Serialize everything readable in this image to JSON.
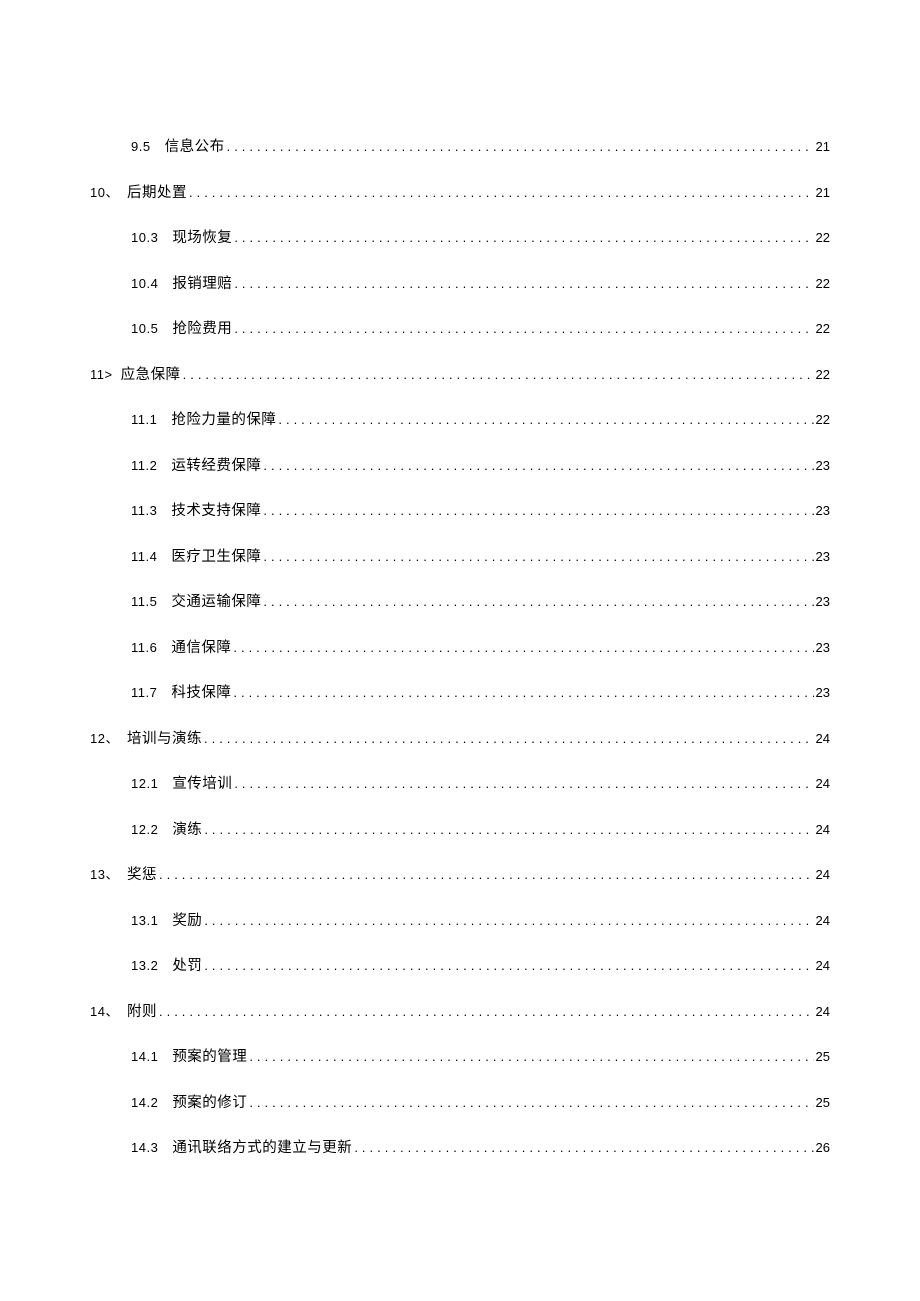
{
  "toc": [
    {
      "level": 2,
      "num": "9.5",
      "title": "信息公布",
      "page": "21"
    },
    {
      "level": 1,
      "num": "10、",
      "title": "后期处置",
      "page": "21"
    },
    {
      "level": 2,
      "num": "10.3",
      "title": "现场恢复",
      "page": "22"
    },
    {
      "level": 2,
      "num": "10.4",
      "title": "报销理赔",
      "page": "22"
    },
    {
      "level": 2,
      "num": "10.5",
      "title": "抢险费用",
      "page": "22"
    },
    {
      "level": 1,
      "num": "11>",
      "title": "应急保障",
      "page": "22"
    },
    {
      "level": 2,
      "num": "11.1",
      "title": "抢险力量的保障",
      "page": "22"
    },
    {
      "level": 2,
      "num": "11.2",
      "title": "运转经费保障",
      "page": "23"
    },
    {
      "level": 2,
      "num": "11.3",
      "title": "技术支持保障",
      "page": "23"
    },
    {
      "level": 2,
      "num": "11.4",
      "title": "医疗卫生保障",
      "page": "23"
    },
    {
      "level": 2,
      "num": "11.5",
      "title": "交通运输保障",
      "page": "23"
    },
    {
      "level": 2,
      "num": "11.6",
      "title": "通信保障",
      "page": "23"
    },
    {
      "level": 2,
      "num": "11.7",
      "title": "科技保障",
      "page": "23"
    },
    {
      "level": 1,
      "num": "12、",
      "title": "培训与演练",
      "page": "24"
    },
    {
      "level": 2,
      "num": "12.1",
      "title": "宣传培训",
      "page": "24"
    },
    {
      "level": 2,
      "num": "12.2",
      "title": "演练",
      "page": "24"
    },
    {
      "level": 1,
      "num": "13、",
      "title": "奖惩",
      "page": "24"
    },
    {
      "level": 2,
      "num": "13.1",
      "title": "奖励",
      "page": "24"
    },
    {
      "level": 2,
      "num": "13.2",
      "title": "处罚",
      "page": "24"
    },
    {
      "level": 1,
      "num": "14、",
      "title": "附则",
      "page": "24"
    },
    {
      "level": 2,
      "num": "14.1",
      "title": "预案的管理",
      "page": "25"
    },
    {
      "level": 2,
      "num": "14.2",
      "title": "预案的修订",
      "page": "25"
    },
    {
      "level": 2,
      "num": "14.3",
      "title": "通讯联络方式的建立与更新",
      "page": "26"
    }
  ]
}
